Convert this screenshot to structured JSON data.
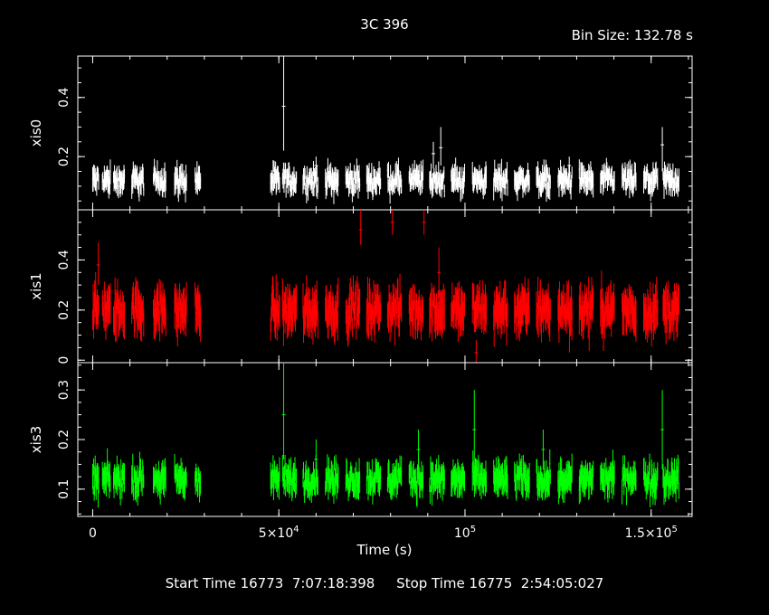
{
  "title": "3C 396",
  "bin_size": "Bin Size: 132.78 s",
  "footer": "Start Time 16773  7:07:18:398     Stop Time 16775  2:54:05:027",
  "chart_data": {
    "type": "scatter",
    "xlabel": "Time (s)",
    "xlim": [
      -4000,
      161000
    ],
    "xticks": [
      {
        "value": 0,
        "label": "0",
        "mant": "",
        "exp": ""
      },
      {
        "value": 50000,
        "label": "",
        "mant": "5×10",
        "exp": "4"
      },
      {
        "value": 100000,
        "label": "",
        "mant": "10",
        "exp": "5"
      },
      {
        "value": 150000,
        "label": "",
        "mant": "1.5×10",
        "exp": "5"
      }
    ],
    "panels": [
      {
        "name": "xis0",
        "color": "#ffffff",
        "ylim": [
          0.02,
          0.54
        ],
        "yticks": [
          {
            "value": 0.2,
            "label": "0.2"
          },
          {
            "value": 0.4,
            "label": "0.4"
          }
        ],
        "base": 0.12,
        "spread": 0.03,
        "spikes": [
          [
            51300,
            0.37,
            0.22,
            0.54
          ],
          [
            60000,
            0.17,
            0.13,
            0.2
          ],
          [
            91500,
            0.21,
            0.16,
            0.25
          ],
          [
            93500,
            0.23,
            0.17,
            0.3
          ],
          [
            153000,
            0.24,
            0.15,
            0.3
          ],
          [
            128000,
            0.17,
            0.14,
            0.2
          ]
        ]
      },
      {
        "name": "xis1",
        "color": "#ff0000",
        "ylim": [
          -0.01,
          0.6
        ],
        "yticks": [
          {
            "value": 0,
            "label": "0"
          },
          {
            "value": 0.2,
            "label": "0.2"
          },
          {
            "value": 0.4,
            "label": "0.4"
          }
        ],
        "base": 0.2,
        "spread": 0.06,
        "spikes": [
          [
            72000,
            0.52,
            0.46,
            0.6
          ],
          [
            80500,
            0.55,
            0.5,
            0.6
          ],
          [
            89000,
            0.55,
            0.5,
            0.6
          ],
          [
            93000,
            0.35,
            0.25,
            0.45
          ],
          [
            1500,
            0.38,
            0.3,
            0.47
          ],
          [
            103000,
            0.03,
            -0.01,
            0.08
          ]
        ]
      },
      {
        "name": "xis3",
        "color": "#00ff00",
        "ylim": [
          0.045,
          0.355
        ],
        "yticks": [
          {
            "value": 0.1,
            "label": "0.1"
          },
          {
            "value": 0.2,
            "label": "0.2"
          },
          {
            "value": 0.3,
            "label": "0.3"
          }
        ],
        "base": 0.12,
        "spread": 0.022,
        "spikes": [
          [
            51300,
            0.25,
            0.16,
            0.355
          ],
          [
            102500,
            0.22,
            0.12,
            0.3
          ],
          [
            153000,
            0.22,
            0.14,
            0.3
          ],
          [
            60000,
            0.16,
            0.12,
            0.2
          ],
          [
            87500,
            0.18,
            0.14,
            0.22
          ],
          [
            121000,
            0.18,
            0.14,
            0.22
          ]
        ]
      }
    ],
    "time_segments": [
      [
        0,
        1700
      ],
      [
        2600,
        4800
      ],
      [
        5600,
        8600
      ],
      [
        10500,
        13800
      ],
      [
        16300,
        19700
      ],
      [
        22000,
        25200
      ],
      [
        27500,
        29000
      ],
      [
        47800,
        50200
      ],
      [
        51000,
        54800
      ],
      [
        56500,
        60500
      ],
      [
        62500,
        66000
      ],
      [
        68000,
        71800
      ],
      [
        73600,
        77400
      ],
      [
        79200,
        83000
      ],
      [
        85000,
        88800
      ],
      [
        90500,
        94500
      ],
      [
        96300,
        100000
      ],
      [
        102000,
        105800
      ],
      [
        107700,
        111500
      ],
      [
        113300,
        117300
      ],
      [
        119200,
        123000
      ],
      [
        125000,
        128800
      ],
      [
        130700,
        134500
      ],
      [
        136400,
        140200
      ],
      [
        142200,
        146000
      ],
      [
        148000,
        151800
      ],
      [
        153200,
        157500
      ]
    ]
  }
}
